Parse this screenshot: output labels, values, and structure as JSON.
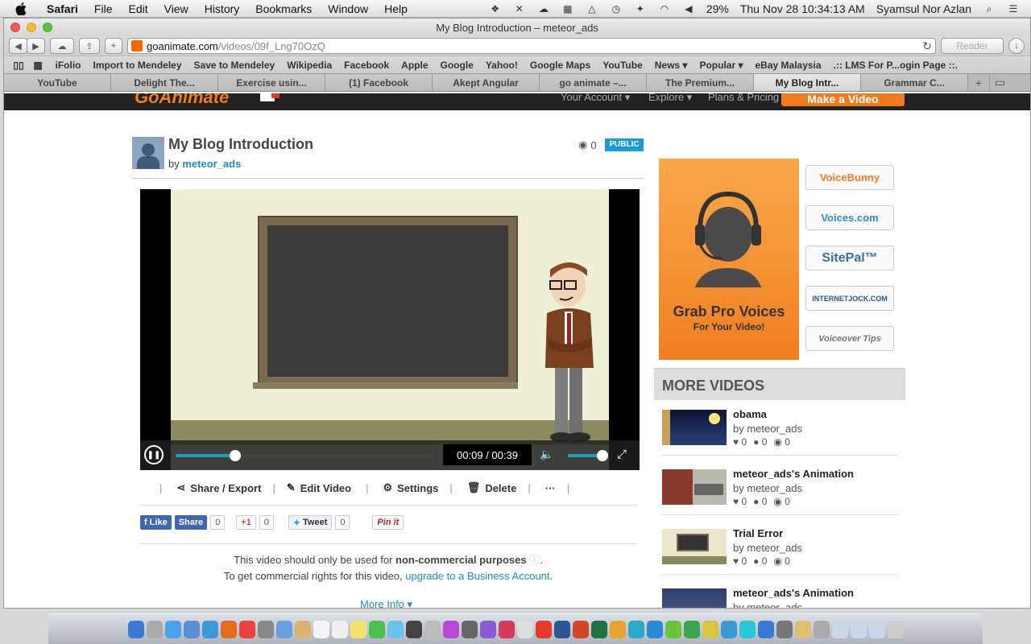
{
  "menubar": {
    "app_name": "Safari",
    "items": [
      "File",
      "Edit",
      "View",
      "History",
      "Bookmarks",
      "Window",
      "Help"
    ],
    "battery": "29%",
    "clock": "Thu Nov 28  10:34:13 AM",
    "user": "Syamsul Nor Azlan"
  },
  "window": {
    "title": "My Blog Introduction – meteor_ads",
    "url_host": "goanimate.com",
    "url_path": "/videos/09f_Lng70OzQ",
    "reader_label": "Reader"
  },
  "bookmarks": [
    "iFolio",
    "Import to Mendeley",
    "Save to Mendeley",
    "Wikipedia",
    "Facebook",
    "Apple",
    "Google",
    "Yahoo!",
    "Google Maps",
    "YouTube",
    "News ▾",
    "Popular ▾",
    "eBay Malaysia",
    ".:: LMS For P...ogin Page ::."
  ],
  "tabs": [
    "YouTube",
    "Delight The...",
    "Exercise usin...",
    "(1) Facebook",
    "Akept Angular",
    "go animate –...",
    "The Premium...",
    "My Blog Intr...",
    "Grammar C..."
  ],
  "site_nav": {
    "logo": "GoAnimate",
    "your_account": "Your Account ▾",
    "explore": "Explore ▾",
    "plans": "Plans & Pricing ▾",
    "make_video": "Make a Video"
  },
  "video": {
    "title": "My Blog Introduction",
    "by_label": "by",
    "author": "meteor_ads",
    "views": "0",
    "visibility": "PUBLIC",
    "time": "00:09 / 00:39",
    "progress": 0.23,
    "volume": 0.85
  },
  "actions": {
    "share": "Share / Export",
    "edit": "Edit Video",
    "settings": "Settings",
    "delete": "Delete",
    "more": "···"
  },
  "social": {
    "fb_like": "Like",
    "fb_share": "Share",
    "fb_count": "0",
    "gplus": "+1",
    "gplus_count": "0",
    "tweet": "Tweet",
    "tweet_count": "0",
    "pinit": "Pin it"
  },
  "notice": {
    "line1_pre": "This video should only be used for",
    "line1_bold": "non-commercial purposes",
    "line2_pre": "To get commercial rights for this video,",
    "line2_link": "upgrade to a Business Account",
    "more_info": "More Info ▾"
  },
  "ad": {
    "headline": "Grab Pro Voices",
    "subline": "For Your Video!",
    "logos": [
      "VoiceBunny",
      "Voices.com",
      "SitePal™",
      "INTERNETJOCK.COM",
      "Voiceover Tips"
    ]
  },
  "more_videos": {
    "heading": "MORE VIDEOS",
    "items": [
      {
        "title": "obama",
        "by": "by meteor_ads",
        "likes": "0",
        "comments": "0",
        "views": "0"
      },
      {
        "title": "meteor_ads's Animation",
        "by": "by meteor_ads",
        "likes": "0",
        "comments": "0",
        "views": "0"
      },
      {
        "title": "Trial Error",
        "by": "by meteor_ads",
        "likes": "0",
        "comments": "0",
        "views": "0"
      },
      {
        "title": "meteor_ads's Animation",
        "by": "by meteor_ads",
        "likes": "",
        "comments": "",
        "views": ""
      }
    ]
  }
}
